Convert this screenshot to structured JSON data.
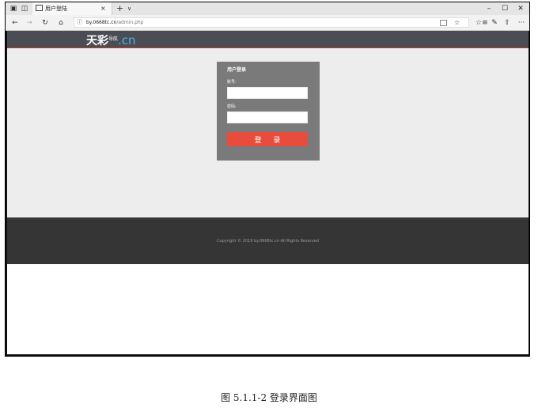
{
  "browser": {
    "tab_title": "用户登陆",
    "tab_close": "×",
    "new_tab": "+",
    "tab_menu": "∨",
    "window_minimize": "–",
    "window_maximize": "☐",
    "window_close": "✕",
    "nav_back": "←",
    "nav_forward": "→",
    "nav_refresh": "↻",
    "nav_home": "⌂",
    "url_info": "ⓘ",
    "url_host": "by.0668tc.cn",
    "url_path": "/admin.php",
    "bookmark_star": "☆",
    "favorites": "☆≡",
    "pen": "✎",
    "share": "⇪",
    "more": "···"
  },
  "site": {
    "logo_main": "天彩",
    "logo_sub": "导航",
    "logo_cn": ".cn"
  },
  "login": {
    "title": "用户登录",
    "account_label": "账号:",
    "account_value": "",
    "password_label": "密码:",
    "password_value": "",
    "submit_label": "登 录"
  },
  "footer": {
    "copyright": "Copyright © 2019  by.0668tc.cn  All Rights Reserved"
  },
  "caption": "图 5.1.1-2 登录界面图",
  "colors": {
    "header_bg": "#4b4d55",
    "accent_red": "#e74c3c",
    "panel_bg": "#7a7a7a",
    "footer_bg": "#353535",
    "logo_blue": "#4ab3e8"
  }
}
